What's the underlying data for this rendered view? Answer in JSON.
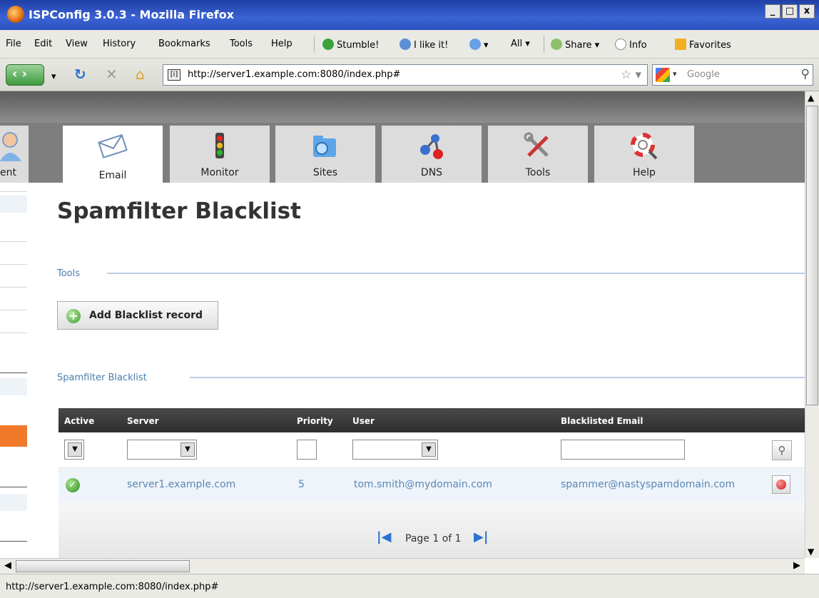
{
  "window": {
    "title": "ISPConfig 3.0.3 - Mozilla Firefox",
    "controls": [
      "_",
      "□",
      "x"
    ]
  },
  "menubar": {
    "items": [
      "File",
      "Edit",
      "View",
      "History",
      "Bookmarks",
      "Tools",
      "Help"
    ],
    "stumble": "Stumble!",
    "ilike": "I like it!",
    "all": "All ▾",
    "share": "Share ▾",
    "info": "Info",
    "favorites": "Favorites"
  },
  "navbar": {
    "url": "http://server1.example.com:8080/index.php#",
    "search_placeholder": "Google"
  },
  "tabs": [
    {
      "label": "ent",
      "icon": "user-icon"
    },
    {
      "label": "Email",
      "icon": "envelope-icon",
      "active": true
    },
    {
      "label": "Monitor",
      "icon": "traffic-light-icon"
    },
    {
      "label": "Sites",
      "icon": "folder-globe-icon"
    },
    {
      "label": "DNS",
      "icon": "network-icon"
    },
    {
      "label": "Tools",
      "icon": "tools-icon"
    },
    {
      "label": "Help",
      "icon": "lifebuoy-icon"
    }
  ],
  "page": {
    "title": "Spamfilter Blacklist",
    "tools_section": "Tools",
    "add_button": "Add Blacklist record",
    "list_section": "Spamfilter Blacklist"
  },
  "table": {
    "headers": {
      "active": "Active",
      "server": "Server",
      "priority": "Priority",
      "user": "User",
      "email": "Blacklisted Email"
    },
    "rows": [
      {
        "active": "yes",
        "server": "server1.example.com",
        "priority": "5",
        "user": "tom.smith@mydomain.com",
        "email": "spammer@nastyspamdomain.com"
      }
    ],
    "pager": "Page 1 of 1"
  },
  "status": {
    "text": "http://server1.example.com:8080/index.php#"
  },
  "colors": {
    "titlebar": "#2b51c0",
    "accent_orange": "#f07a2a",
    "link_blue": "#5b86b4",
    "table_header": "#3a3a3a"
  }
}
